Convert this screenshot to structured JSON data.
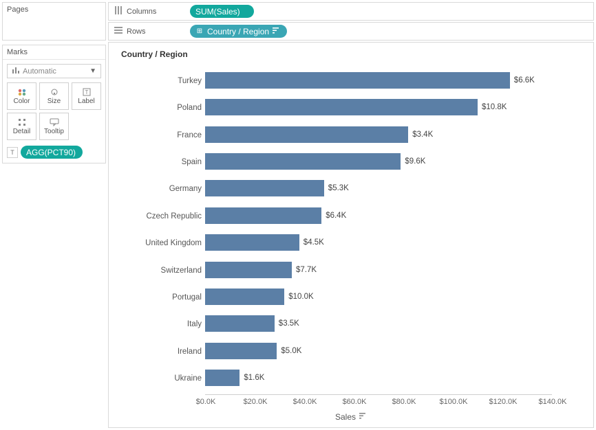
{
  "panels": {
    "pages_title": "Pages",
    "marks_title": "Marks"
  },
  "marks": {
    "dropdown_label": "Automatic",
    "cells": [
      "Color",
      "Size",
      "Label",
      "Detail",
      "Tooltip"
    ],
    "agg_pill": "AGG(PCT90)",
    "agg_icon": "T"
  },
  "shelves": {
    "columns_label": "Columns",
    "rows_label": "Rows",
    "columns_pill": "SUM(Sales)",
    "rows_pill": "Country / Region"
  },
  "chart_data": {
    "type": "bar",
    "title": "Country / Region",
    "xlabel": "Sales",
    "ylabel": "",
    "xlim": [
      0,
      140000
    ],
    "categories": [
      "Turkey",
      "Poland",
      "France",
      "Spain",
      "Germany",
      "Czech Republic",
      "United Kingdom",
      "Switzerland",
      "Portugal",
      "Italy",
      "Ireland",
      "Ukraine"
    ],
    "values": [
      123000,
      110000,
      82000,
      79000,
      48000,
      47000,
      38000,
      35000,
      32000,
      28000,
      29000,
      14000
    ],
    "value_labels": [
      "$6.6K",
      "$10.8K",
      "$3.4K",
      "$9.6K",
      "$5.3K",
      "$6.4K",
      "$4.5K",
      "$7.7K",
      "$10.0K",
      "$3.5K",
      "$5.0K",
      "$1.6K"
    ],
    "xticks": [
      0,
      20000,
      40000,
      60000,
      80000,
      100000,
      120000,
      140000
    ],
    "xtick_labels": [
      "$0.0K",
      "$20.0K",
      "$40.0K",
      "$60.0K",
      "$80.0K",
      "$100.0K",
      "$120.0K",
      "$140.0K"
    ]
  }
}
